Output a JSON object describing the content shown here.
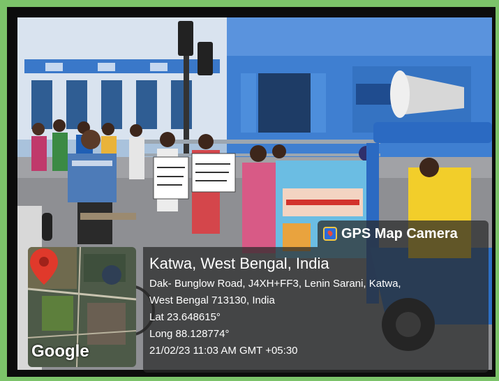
{
  "overlay": {
    "app_name": "GPS Map Camera",
    "location_title": "Katwa, West Bengal, India",
    "address_line1": "Dak- Bunglow Road, J4XH+FF3, Lenin Sarani, Katwa,",
    "address_line2": "West Bengal 713130, India",
    "latitude": "Lat 23.648615°",
    "longitude": "Long 88.128774°",
    "datetime": "21/02/23 11:03 AM GMT +05:30",
    "map_brand": "Google"
  },
  "icons": [
    "map-pin-icon",
    "gps-map-camera-icon"
  ],
  "colors": {
    "frame_green": "#7cc36a",
    "frame_black": "#0c0c0c",
    "building_blue": "#3f7fd1",
    "overlay_bg": "rgba(40,40,40,0.72)",
    "pin_red": "#e0392b"
  }
}
